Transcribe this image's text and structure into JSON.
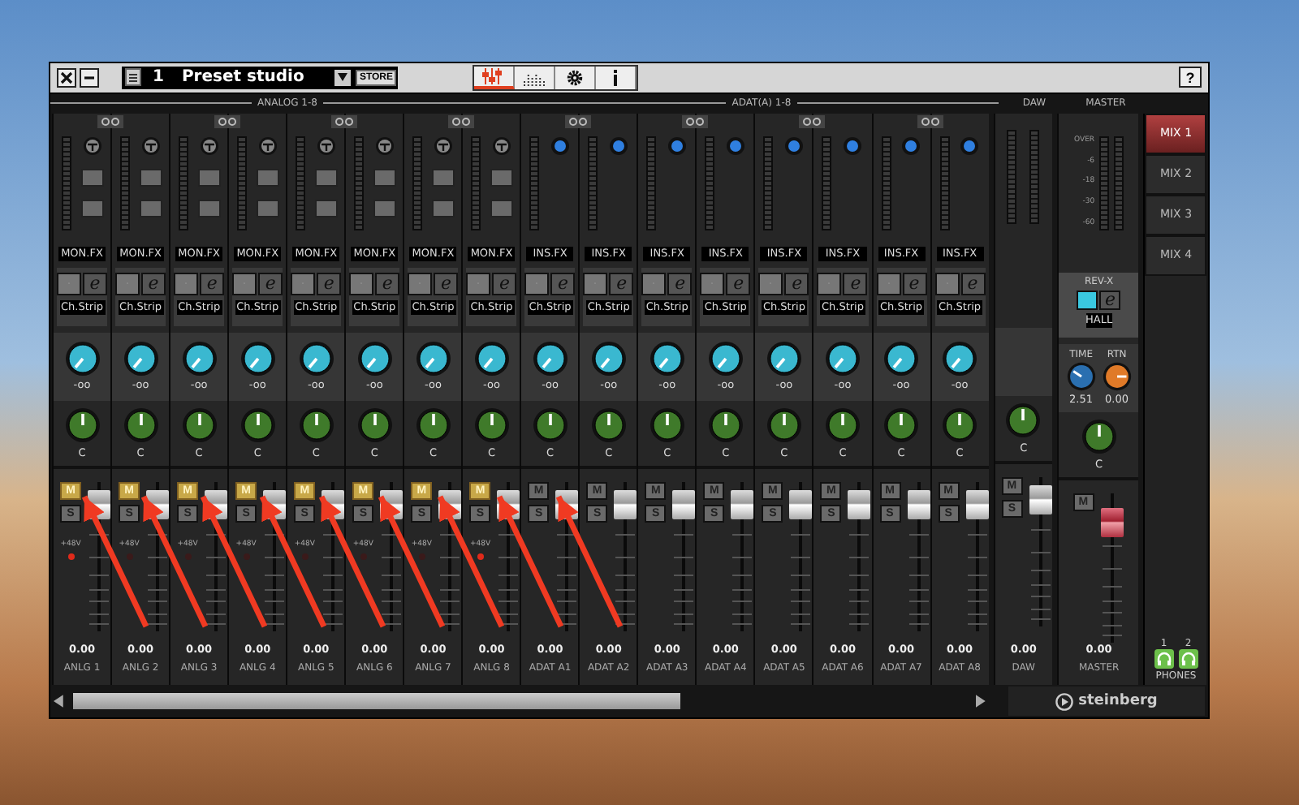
{
  "window": {
    "help": "?"
  },
  "preset": {
    "number": "1",
    "name": "Preset studio",
    "store": "STORE"
  },
  "tabs": [
    {
      "kind": "mixer",
      "selected": true
    },
    {
      "kind": "meters",
      "selected": false
    },
    {
      "kind": "settings",
      "selected": false
    },
    {
      "kind": "info",
      "selected": false
    }
  ],
  "groups": [
    {
      "label": "ANALOG 1-8"
    },
    {
      "label": "ADAT(A) 1-8"
    }
  ],
  "channels": [
    {
      "name": "ANLG 1",
      "kind": "analog",
      "fx": "MON.FX",
      "editor": "e",
      "strip": "Ch.Strip",
      "send": "-oo",
      "pan": "C",
      "mute_label": "M",
      "muted": true,
      "solo_label": "S",
      "soloed": false,
      "phantom_label": "+48V",
      "phantom": true,
      "level": 0.85,
      "value": "0.00",
      "arrow": true
    },
    {
      "name": "ANLG 2",
      "kind": "analog",
      "fx": "MON.FX",
      "editor": "e",
      "strip": "Ch.Strip",
      "send": "-oo",
      "pan": "C",
      "mute_label": "M",
      "muted": true,
      "solo_label": "S",
      "soloed": false,
      "phantom_label": "+48V",
      "phantom": false,
      "level": 0.85,
      "value": "0.00",
      "arrow": true
    },
    {
      "name": "ANLG 3",
      "kind": "analog",
      "fx": "MON.FX",
      "editor": "e",
      "strip": "Ch.Strip",
      "send": "-oo",
      "pan": "C",
      "mute_label": "M",
      "muted": true,
      "solo_label": "S",
      "soloed": false,
      "phantom_label": "+48V",
      "phantom": false,
      "level": 0.85,
      "value": "0.00",
      "arrow": true
    },
    {
      "name": "ANLG 4",
      "kind": "analog",
      "fx": "MON.FX",
      "editor": "e",
      "strip": "Ch.Strip",
      "send": "-oo",
      "pan": "C",
      "mute_label": "M",
      "muted": true,
      "solo_label": "S",
      "soloed": false,
      "phantom_label": "+48V",
      "phantom": false,
      "level": 0.85,
      "value": "0.00",
      "arrow": true
    },
    {
      "name": "ANLG 5",
      "kind": "analog",
      "fx": "MON.FX",
      "editor": "e",
      "strip": "Ch.Strip",
      "send": "-oo",
      "pan": "C",
      "mute_label": "M",
      "muted": true,
      "solo_label": "S",
      "soloed": false,
      "phantom_label": "+48V",
      "phantom": false,
      "level": 0.85,
      "value": "0.00",
      "arrow": true
    },
    {
      "name": "ANLG 6",
      "kind": "analog",
      "fx": "MON.FX",
      "editor": "e",
      "strip": "Ch.Strip",
      "send": "-oo",
      "pan": "C",
      "mute_label": "M",
      "muted": true,
      "solo_label": "S",
      "soloed": false,
      "phantom_label": "+48V",
      "phantom": false,
      "level": 0.85,
      "value": "0.00",
      "arrow": true
    },
    {
      "name": "ANLG 7",
      "kind": "analog",
      "fx": "MON.FX",
      "editor": "e",
      "strip": "Ch.Strip",
      "send": "-oo",
      "pan": "C",
      "mute_label": "M",
      "muted": true,
      "solo_label": "S",
      "soloed": false,
      "phantom_label": "+48V",
      "phantom": false,
      "level": 0.85,
      "value": "0.00",
      "arrow": true
    },
    {
      "name": "ANLG 8",
      "kind": "analog",
      "fx": "MON.FX",
      "editor": "e",
      "strip": "Ch.Strip",
      "send": "-oo",
      "pan": "C",
      "mute_label": "M",
      "muted": true,
      "solo_label": "S",
      "soloed": false,
      "phantom_label": "+48V",
      "phantom": true,
      "level": 0.85,
      "value": "0.00",
      "arrow": true
    },
    {
      "name": "ADAT A1",
      "kind": "adat",
      "fx": "INS.FX",
      "editor": "e",
      "strip": "Ch.Strip",
      "send": "-oo",
      "pan": "C",
      "mute_label": "M",
      "muted": false,
      "solo_label": "S",
      "soloed": false,
      "level": 0.85,
      "value": "0.00",
      "arrow": true
    },
    {
      "name": "ADAT A2",
      "kind": "adat",
      "fx": "INS.FX",
      "editor": "e",
      "strip": "Ch.Strip",
      "send": "-oo",
      "pan": "C",
      "mute_label": "M",
      "muted": false,
      "solo_label": "S",
      "soloed": false,
      "level": 0.85,
      "value": "0.00",
      "arrow": false
    },
    {
      "name": "ADAT A3",
      "kind": "adat",
      "fx": "INS.FX",
      "editor": "e",
      "strip": "Ch.Strip",
      "send": "-oo",
      "pan": "C",
      "mute_label": "M",
      "muted": false,
      "solo_label": "S",
      "soloed": false,
      "level": 0.85,
      "value": "0.00",
      "arrow": false
    },
    {
      "name": "ADAT A4",
      "kind": "adat",
      "fx": "INS.FX",
      "editor": "e",
      "strip": "Ch.Strip",
      "send": "-oo",
      "pan": "C",
      "mute_label": "M",
      "muted": false,
      "solo_label": "S",
      "soloed": false,
      "level": 0.85,
      "value": "0.00",
      "arrow": false
    },
    {
      "name": "ADAT A5",
      "kind": "adat",
      "fx": "INS.FX",
      "editor": "e",
      "strip": "Ch.Strip",
      "send": "-oo",
      "pan": "C",
      "mute_label": "M",
      "muted": false,
      "solo_label": "S",
      "soloed": false,
      "level": 0.85,
      "value": "0.00",
      "arrow": false
    },
    {
      "name": "ADAT A6",
      "kind": "adat",
      "fx": "INS.FX",
      "editor": "e",
      "strip": "Ch.Strip",
      "send": "-oo",
      "pan": "C",
      "mute_label": "M",
      "muted": false,
      "solo_label": "S",
      "soloed": false,
      "level": 0.85,
      "value": "0.00",
      "arrow": false
    },
    {
      "name": "ADAT A7",
      "kind": "adat",
      "fx": "INS.FX",
      "editor": "e",
      "strip": "Ch.Strip",
      "send": "-oo",
      "pan": "C",
      "mute_label": "M",
      "muted": false,
      "solo_label": "S",
      "soloed": false,
      "level": 0.85,
      "value": "0.00",
      "arrow": false
    },
    {
      "name": "ADAT A8",
      "kind": "adat",
      "fx": "INS.FX",
      "editor": "e",
      "strip": "Ch.Strip",
      "send": "-oo",
      "pan": "C",
      "mute_label": "M",
      "muted": false,
      "solo_label": "S",
      "soloed": false,
      "level": 0.85,
      "value": "0.00",
      "arrow": false
    }
  ],
  "daw": {
    "header": "DAW",
    "pan": "C",
    "mute_label": "M",
    "muted": false,
    "solo_label": "S",
    "soloed": false,
    "level": 0.85,
    "value": "0.00",
    "name": "DAW"
  },
  "master": {
    "header": "MASTER",
    "scale": [
      "OVER",
      "-6",
      "-18",
      "-30",
      "-60"
    ],
    "reverb": "REV-X",
    "send_on": true,
    "editor": "e",
    "reverb_type": "HALL",
    "time_label": "TIME",
    "time": "2.51",
    "rtn_label": "RTN",
    "rtn": "0.00",
    "pan": "C",
    "mute_label": "M",
    "muted": false,
    "level": 0.8,
    "value": "0.00",
    "name": "MASTER"
  },
  "mixes": [
    {
      "label": "MIX 1",
      "selected": true
    },
    {
      "label": "MIX 2",
      "selected": false
    },
    {
      "label": "MIX 3",
      "selected": false
    },
    {
      "label": "MIX 4",
      "selected": false
    }
  ],
  "phones": {
    "outputs": [
      "1",
      "2"
    ],
    "label": "PHONES"
  },
  "brand": "steinberg"
}
